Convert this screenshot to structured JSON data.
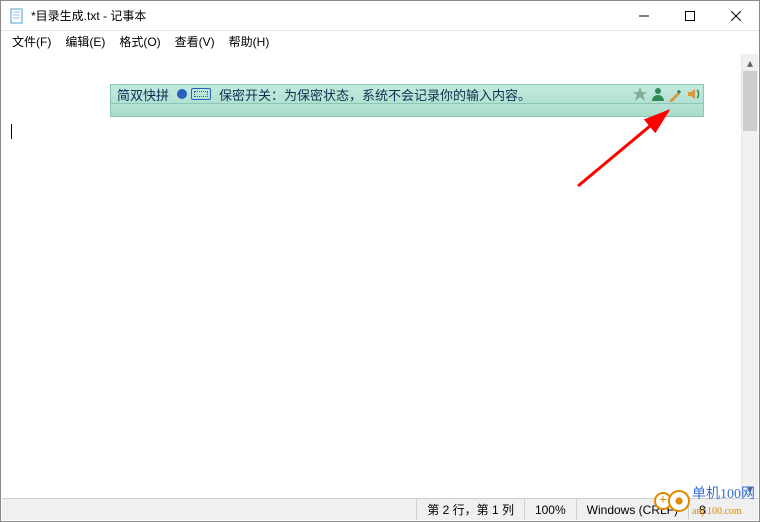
{
  "titlebar": {
    "title": "*目录生成.txt - 记事本"
  },
  "menu": {
    "file": "文件(F)",
    "edit": "编辑(E)",
    "format": "格式(O)",
    "view": "查看(V)",
    "help": "帮助(H)"
  },
  "ime": {
    "mode": "简双快拼",
    "message": "保密开关：为保密状态，系统不会记录你的输入内容。"
  },
  "status": {
    "pos": "第 2 行，第 1 列",
    "zoom": "100%",
    "lineend": "Windows (CRLF)",
    "encoding_partial": "8"
  },
  "watermark": {
    "plus": "+",
    "brand": "单机100网",
    "domain": "anji100.com"
  }
}
